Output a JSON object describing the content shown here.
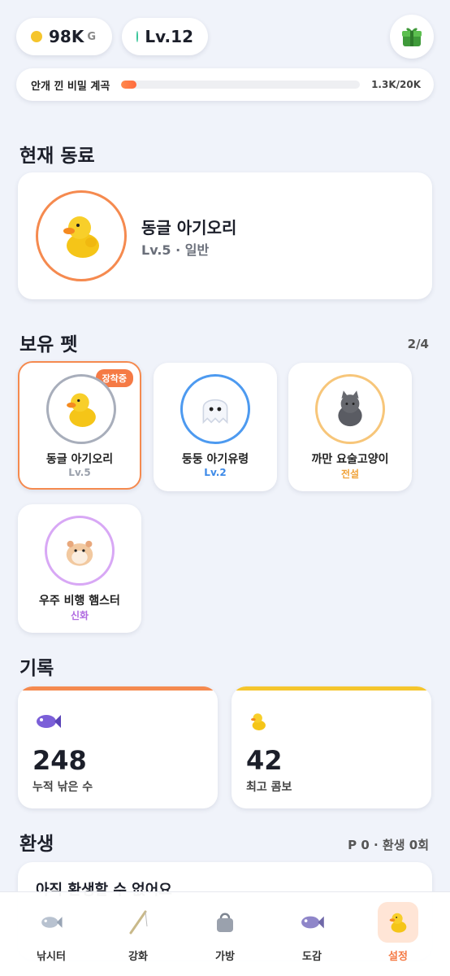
{
  "header": {
    "gold_value": "98K",
    "gold_unit": "G",
    "level": "Lv.12",
    "gold_color": "#f5c52c",
    "level_color": "#39c59a",
    "pack_icon": "gift-box-icon"
  },
  "quest": {
    "label": "안개 낀 비밀 계곡",
    "count": "1.3K/20K",
    "progress": 0.065
  },
  "current": {
    "section_title": "현재 동료",
    "name": "동글 아기오리",
    "sub": "Lv.5 · 일반"
  },
  "pets": {
    "section_title": "보유 펫",
    "count": "2/4",
    "equipped_badge": "장착중",
    "items": [
      {
        "name": "동글 아기오리",
        "sub": "Lv.5",
        "ring": "#a8aebb",
        "sub_color": "#9aa0ab",
        "icon": "duck-icon"
      },
      {
        "name": "둥둥 아기유령",
        "sub": "Lv.2",
        "ring": "#4d9af0",
        "sub_color": "#3d8ae8",
        "icon": "ghost-icon"
      },
      {
        "name": "까만 요술고양이",
        "sub": "전설",
        "ring": "#f7c67a",
        "sub_color": "#f0a33a",
        "icon": "cat-icon"
      },
      {
        "name": "우주 비행 햄스터",
        "sub": "신화",
        "ring": "#d8a8f5",
        "sub_color": "#b06ae0",
        "icon": "hamster-icon"
      }
    ]
  },
  "records": {
    "section_title": "기록",
    "items": [
      {
        "value": "248",
        "label": "누적 낚은 수",
        "bar": "#f58a4f",
        "icon": "fish-icon"
      },
      {
        "value": "42",
        "label": "최고 콤보",
        "bar": "#f5c52c",
        "icon": "duck-icon"
      }
    ]
  },
  "rebirth": {
    "section_title": "환생",
    "stats": "P 0 · 환생 0회",
    "message": "아직 환생할 수 없어요"
  },
  "tabs": [
    {
      "label": "낚시터",
      "icon": "fish-icon"
    },
    {
      "label": "강화",
      "icon": "fishing-rod-icon"
    },
    {
      "label": "가방",
      "icon": "bag-icon"
    },
    {
      "label": "도감",
      "icon": "fish-book-icon"
    },
    {
      "label": "설정",
      "icon": "duck-icon"
    }
  ]
}
